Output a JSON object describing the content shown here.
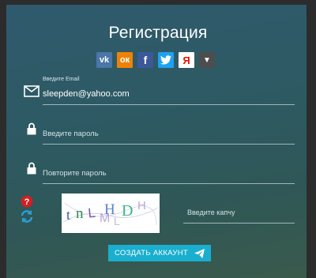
{
  "form": {
    "title": "Регистрация",
    "social": [
      {
        "name": "vk",
        "glyph": "vk",
        "color": "#4a76a8"
      },
      {
        "name": "odnoklassniki",
        "glyph": "ок",
        "color": "#ee8208"
      },
      {
        "name": "facebook",
        "glyph": "f",
        "color": "#3b5998"
      },
      {
        "name": "twitter",
        "glyph": "t",
        "color": "#1da1f2"
      },
      {
        "name": "yandex",
        "glyph": "Я",
        "color": "#ffffff"
      },
      {
        "name": "more",
        "glyph": "▼",
        "color": "#555555"
      }
    ],
    "email": {
      "label": "Введите Email",
      "value": "sleepden@yahoo.com"
    },
    "password": {
      "placeholder": "Введите пароль"
    },
    "password_repeat": {
      "placeholder": "Повторите пароль"
    },
    "captcha": {
      "image_text": "tnLHD",
      "placeholder": "Введите капчу"
    },
    "submit_label": "СОЗДАТЬ АККАУНТ"
  },
  "colors": {
    "accent": "#1aaecf",
    "error": "#d22020",
    "refresh": "#2a9fd8"
  }
}
